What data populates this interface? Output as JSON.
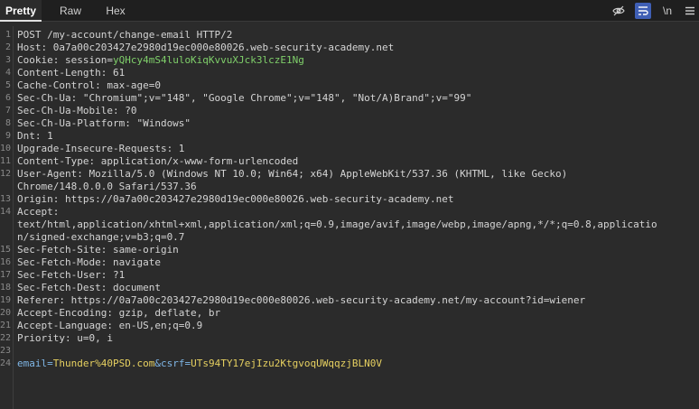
{
  "tabs": [
    {
      "label": "Pretty",
      "active": true
    },
    {
      "label": "Raw",
      "active": false
    },
    {
      "label": "Hex",
      "active": false
    }
  ],
  "toolbar_icons": [
    {
      "name": "eye-off-icon",
      "active": false
    },
    {
      "name": "wrap-lines-icon",
      "active": true
    },
    {
      "name": "newline-toggle",
      "label": "\\n",
      "active": false
    },
    {
      "name": "menu-icon",
      "active": false
    }
  ],
  "lines": [
    {
      "n": "1",
      "text": "POST /my-account/change-email HTTP/2"
    },
    {
      "n": "2",
      "text": "Host: 0a7a00c203427e2980d19ec000e80026.web-security-academy.net"
    },
    {
      "n": "3",
      "text": "Cookie: session=yQHcy4mS4luloKiqKvvuXJck3lczE1Ng"
    },
    {
      "n": "4",
      "text": "Content-Length: 61"
    },
    {
      "n": "5",
      "text": "Cache-Control: max-age=0"
    },
    {
      "n": "6",
      "text": "Sec-Ch-Ua: \"Chromium\";v=\"148\", \"Google Chrome\";v=\"148\", \"Not/A)Brand\";v=\"99\""
    },
    {
      "n": "7",
      "text": "Sec-Ch-Ua-Mobile: ?0"
    },
    {
      "n": "8",
      "text": "Sec-Ch-Ua-Platform: \"Windows\""
    },
    {
      "n": "9",
      "text": "Dnt: 1"
    },
    {
      "n": "10",
      "text": "Upgrade-Insecure-Requests: 1"
    },
    {
      "n": "11",
      "text": "Content-Type: application/x-www-form-urlencoded"
    },
    {
      "n": "12",
      "text": "User-Agent: Mozilla/5.0 (Windows NT 10.0; Win64; x64) AppleWebKit/537.36 (KHTML, like Gecko)"
    },
    {
      "n": "",
      "text": "Chrome/148.0.0.0 Safari/537.36"
    },
    {
      "n": "13",
      "text": "Origin: https://0a7a00c203427e2980d19ec000e80026.web-security-academy.net"
    },
    {
      "n": "14",
      "text": "Accept:"
    },
    {
      "n": "",
      "text": "text/html,application/xhtml+xml,application/xml;q=0.9,image/avif,image/webp,image/apng,*/*;q=0.8,applicatio"
    },
    {
      "n": "",
      "text": "n/signed-exchange;v=b3;q=0.7"
    },
    {
      "n": "15",
      "text": "Sec-Fetch-Site: same-origin"
    },
    {
      "n": "16",
      "text": "Sec-Fetch-Mode: navigate"
    },
    {
      "n": "17",
      "text": "Sec-Fetch-User: ?1"
    },
    {
      "n": "18",
      "text": "Sec-Fetch-Dest: document"
    },
    {
      "n": "19",
      "text": "Referer: https://0a7a00c203427e2980d19ec000e80026.web-security-academy.net/my-account?id=wiener"
    },
    {
      "n": "20",
      "text": "Accept-Encoding: gzip, deflate, br"
    },
    {
      "n": "21",
      "text": "Accept-Language: en-US,en;q=0.9"
    },
    {
      "n": "22",
      "text": "Priority: u=0, i"
    },
    {
      "n": "23",
      "text": ""
    },
    {
      "n": "24",
      "text": "email=Thunder%40PSD.com&csrf=UTs94TY17ejIzu2KtgvoqUWqqzjBLN0V"
    }
  ],
  "colors": {
    "background": "#2b2b2b",
    "text": "#d4d4d4",
    "cookie_value": "#7fcf6a",
    "body_key": "#7fb6e6",
    "body_value": "#e6d060",
    "active_icon_bg": "#3f5fb5"
  }
}
